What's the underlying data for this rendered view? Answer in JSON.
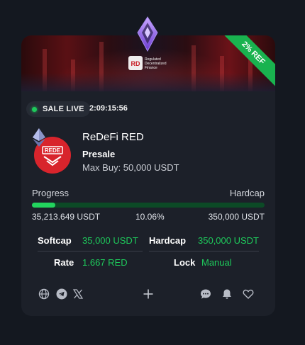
{
  "sale": {
    "status_label": "SALE LIVE",
    "countdown": "2:09:15:56",
    "ref_ribbon": "2% REF"
  },
  "banner": {
    "line1": "Regulated",
    "line2": "Decentralized",
    "line3": "Finance"
  },
  "token": {
    "name": "ReDeFi RED",
    "stage": "Presale",
    "max_buy": "Max Buy: 50,000 USDT",
    "logo_text": "REDE",
    "chain_icon": "ethereum-icon"
  },
  "progress": {
    "label_left": "Progress",
    "label_right": "Hardcap",
    "raised": "35,213.649 USDT",
    "percent": "10.06%",
    "percent_value": 0.1006,
    "hardcap": "350,000 USDT"
  },
  "stats": {
    "softcap_label": "Softcap",
    "softcap_value": "35,000 USDT",
    "hardcap_label": "Hardcap",
    "hardcap_value": "350,000 USDT",
    "rate_label": "Rate",
    "rate_value": "1.667 RED",
    "lock_label": "Lock",
    "lock_value": "Manual"
  },
  "footer_icons": [
    "globe-icon",
    "telegram-icon",
    "x-icon",
    "plus-icon",
    "chat-icon",
    "bell-icon",
    "heart-icon"
  ],
  "colors": {
    "accent_green": "#1ec95b",
    "card_bg": "#1c2029",
    "page_bg": "#141820",
    "token_red": "#d8242c"
  }
}
